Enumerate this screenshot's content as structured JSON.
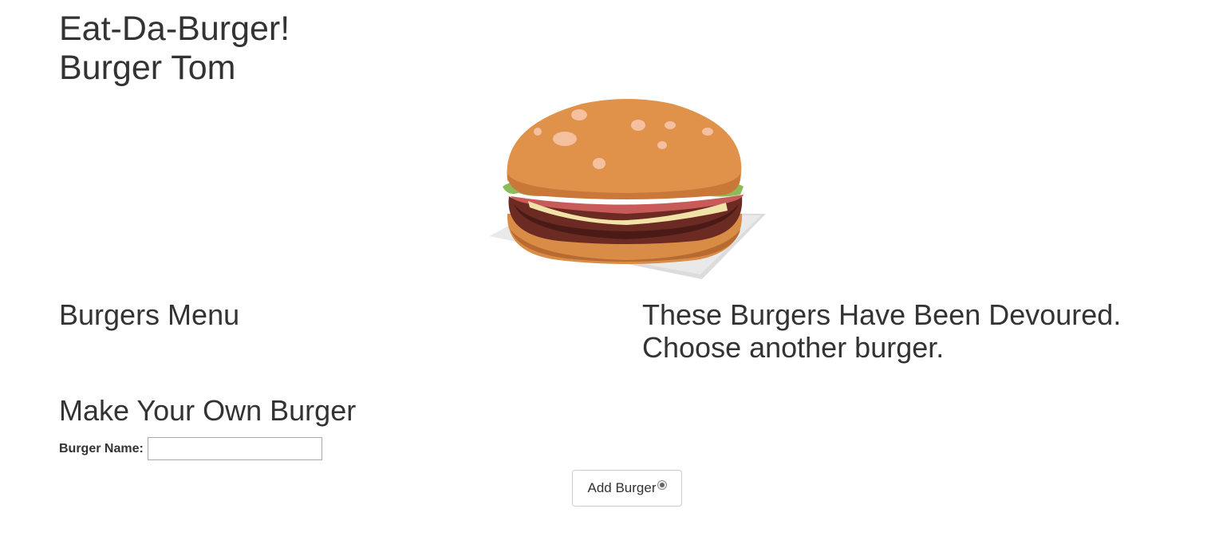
{
  "header": {
    "title": "Eat-Da-Burger!",
    "subtitle": "Burger Tom"
  },
  "hero": {
    "image_icon": "hamburger-illustration"
  },
  "menu": {
    "heading": "Burgers Menu"
  },
  "devoured": {
    "heading_line1": "These Burgers Have Been Devoured.",
    "heading_line2": "Choose another burger."
  },
  "form": {
    "heading": "Make Your Own Burger",
    "name_label": "Burger Name:",
    "name_value": "",
    "submit_label": "Add Burger"
  }
}
